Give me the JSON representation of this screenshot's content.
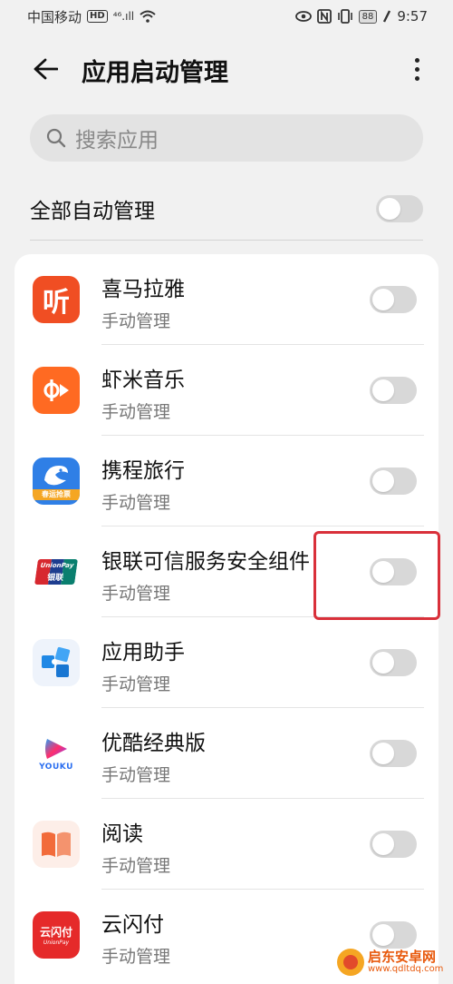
{
  "status_bar": {
    "carrier": "中国移动",
    "hd_badge": "HD",
    "network": "⁴⁶.ıll",
    "battery": "88",
    "time": "9:57"
  },
  "header": {
    "title": "应用启动管理"
  },
  "search": {
    "placeholder": "搜索应用"
  },
  "global_toggle": {
    "label": "全部自动管理",
    "on": false
  },
  "apps": [
    {
      "name": "喜马拉雅",
      "status": "手动管理",
      "icon": "ximalaya-icon",
      "on": false
    },
    {
      "name": "虾米音乐",
      "status": "手动管理",
      "icon": "xiami-icon",
      "on": false
    },
    {
      "name": "携程旅行",
      "status": "手动管理",
      "icon": "ctrip-icon",
      "on": false
    },
    {
      "name": "银联可信服务安全组件",
      "status": "手动管理",
      "icon": "unionpay-icon",
      "on": false
    },
    {
      "name": "应用助手",
      "status": "手动管理",
      "icon": "app-assistant-icon",
      "on": false
    },
    {
      "name": "优酷经典版",
      "status": "手动管理",
      "icon": "youku-icon",
      "on": false
    },
    {
      "name": "阅读",
      "status": "手动管理",
      "icon": "reading-icon",
      "on": false
    },
    {
      "name": "云闪付",
      "status": "手动管理",
      "icon": "yunshanfu-icon",
      "on": false
    }
  ],
  "icon_text": {
    "ximalaya": "听",
    "youku": "YOUKU",
    "unionpay": "UnionPay",
    "unionpay_cn": "银联",
    "ctrip_tag": "春运抢票",
    "yunshanfu": "云闪付"
  },
  "watermark": {
    "title": "启东安卓网",
    "url": "www.qdltdq.com"
  },
  "colors": {
    "highlight": "#d9303a",
    "toggle_off": "#d8d8d8",
    "background": "#f1f1f1"
  }
}
